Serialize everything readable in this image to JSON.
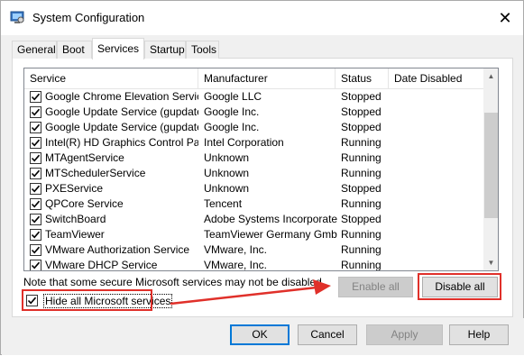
{
  "window": {
    "title": "System Configuration",
    "close_glyph": "✕"
  },
  "tabs": [
    {
      "label": "General"
    },
    {
      "label": "Boot"
    },
    {
      "label": "Services"
    },
    {
      "label": "Startup"
    },
    {
      "label": "Tools"
    }
  ],
  "services_table": {
    "columns": [
      "Service",
      "Manufacturer",
      "Status",
      "Date Disabled"
    ],
    "rows": [
      {
        "service": "Google Chrome Elevation Servic...",
        "manufacturer": "Google LLC",
        "status": "Stopped",
        "date_disabled": "",
        "checked": true
      },
      {
        "service": "Google Update Service (gupdate)",
        "manufacturer": "Google Inc.",
        "status": "Stopped",
        "date_disabled": "",
        "checked": true
      },
      {
        "service": "Google Update Service (gupdatem)",
        "manufacturer": "Google Inc.",
        "status": "Stopped",
        "date_disabled": "",
        "checked": true
      },
      {
        "service": "Intel(R) HD Graphics Control Pa...",
        "manufacturer": "Intel Corporation",
        "status": "Running",
        "date_disabled": "",
        "checked": true
      },
      {
        "service": "MTAgentService",
        "manufacturer": "Unknown",
        "status": "Running",
        "date_disabled": "",
        "checked": true
      },
      {
        "service": "MTSchedulerService",
        "manufacturer": "Unknown",
        "status": "Running",
        "date_disabled": "",
        "checked": true
      },
      {
        "service": "PXEService",
        "manufacturer": "Unknown",
        "status": "Stopped",
        "date_disabled": "",
        "checked": true
      },
      {
        "service": "QPCore Service",
        "manufacturer": "Tencent",
        "status": "Running",
        "date_disabled": "",
        "checked": true
      },
      {
        "service": "SwitchBoard",
        "manufacturer": "Adobe Systems Incorporated",
        "status": "Stopped",
        "date_disabled": "",
        "checked": true
      },
      {
        "service": "TeamViewer",
        "manufacturer": "TeamViewer Germany GmbH",
        "status": "Running",
        "date_disabled": "",
        "checked": true
      },
      {
        "service": "VMware Authorization Service",
        "manufacturer": "VMware, Inc.",
        "status": "Running",
        "date_disabled": "",
        "checked": true
      },
      {
        "service": "VMware DHCP Service",
        "manufacturer": "VMware, Inc.",
        "status": "Running",
        "date_disabled": "",
        "checked": true
      }
    ]
  },
  "note": "Note that some secure Microsoft services may not be disabled.",
  "hide_microsoft": {
    "label": "Hide all Microsoft services",
    "checked": true
  },
  "buttons": {
    "enable_all": "Enable all",
    "disable_all": "Disable all",
    "ok": "OK",
    "cancel": "Cancel",
    "apply": "Apply",
    "help": "Help"
  },
  "colors": {
    "highlight": "#e0302a",
    "selection": "#0078d7"
  }
}
